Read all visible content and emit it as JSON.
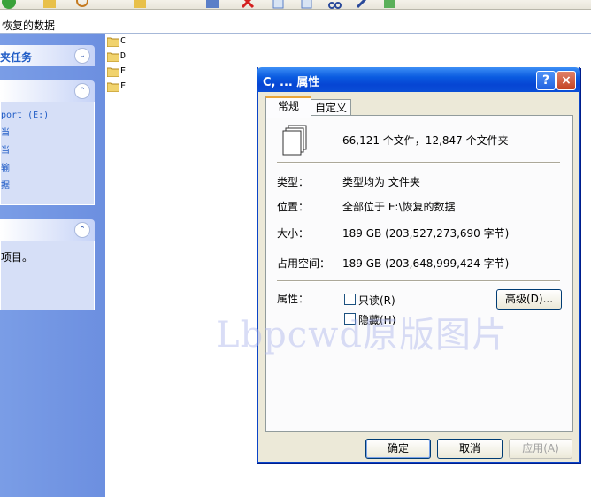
{
  "address": {
    "path": "恢复的数据"
  },
  "taskpane": {
    "group1": {
      "title": "夹任务"
    },
    "group2": {
      "items": [
        "port (E:)",
        "当",
        "当",
        "输",
        "据"
      ]
    },
    "group3": {
      "text": "项目。"
    }
  },
  "tree": {
    "items": [
      "C",
      "D",
      "E",
      "F"
    ]
  },
  "watermark": "Lbpcwd原版图片",
  "dialog": {
    "title": "C, ... 属性",
    "help": "?",
    "close": "×",
    "tabs": [
      "常规",
      "自定义"
    ],
    "summary": "66,121 个文件，12,847 个文件夹",
    "type_label": "类型：",
    "type_value": "类型均为 文件夹",
    "location_label": "位置：",
    "location_value": "全部位于 E:\\恢复的数据",
    "size_label": "大小：",
    "size_value": "189 GB (203,527,273,690 字节)",
    "disk_label": "占用空间：",
    "disk_value": "189 GB (203,648,999,424 字节)",
    "attr_label": "属性：",
    "readonly": "只读(R)",
    "hidden": "隐藏(H)",
    "advanced": "高级(D)...",
    "ok": "确定",
    "cancel": "取消",
    "apply": "应用(A)"
  }
}
